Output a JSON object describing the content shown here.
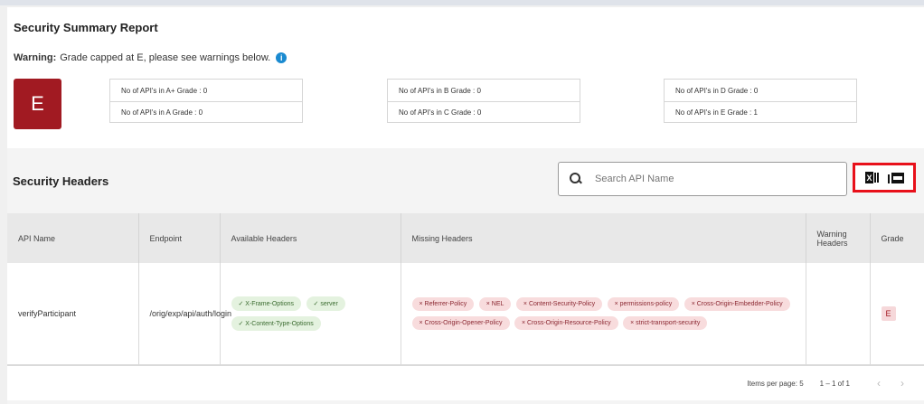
{
  "report": {
    "title": "Security Summary Report",
    "warning_label": "Warning:",
    "warning_text": "Grade capped at E, please see warnings below.",
    "overall_grade": "E",
    "grade_counts": [
      [
        "No of API's in A+ Grade : 0",
        "No of API's in A Grade : 0"
      ],
      [
        "No of API's in B Grade : 0",
        "No of API's in C Grade : 0"
      ],
      [
        "No of API's in D Grade : 0",
        "No of API's in E Grade : 1"
      ]
    ]
  },
  "security_headers": {
    "title": "Security Headers",
    "search_placeholder": "Search API Name",
    "columns": [
      "API Name",
      "Endpoint",
      "Available Headers",
      "Missing Headers",
      "Warning Headers",
      "Grade"
    ],
    "rows": [
      {
        "api_name": "verifyParticipant",
        "endpoint": "/orig/exp/api/auth/login",
        "available": [
          "✓ X-Frame-Options",
          "✓ server",
          "✓ X-Content-Type-Options"
        ],
        "missing": [
          "× Referrer-Policy",
          "× NEL",
          "× Content-Security-Policy",
          "× permissions-policy",
          "× Cross-Origin-Embedder-Policy",
          "× Cross-Origin-Opener-Policy",
          "× Cross-Origin-Resource-Policy",
          "× strict-transport-security"
        ],
        "warning": "",
        "grade": "E"
      }
    ]
  },
  "pagination": {
    "items_per_page_label": "Items per page:",
    "items_per_page": "5",
    "range": "1 – 1 of 1"
  },
  "colors": {
    "grade_e": "#a11a22",
    "export_highlight": "#e8101a"
  }
}
